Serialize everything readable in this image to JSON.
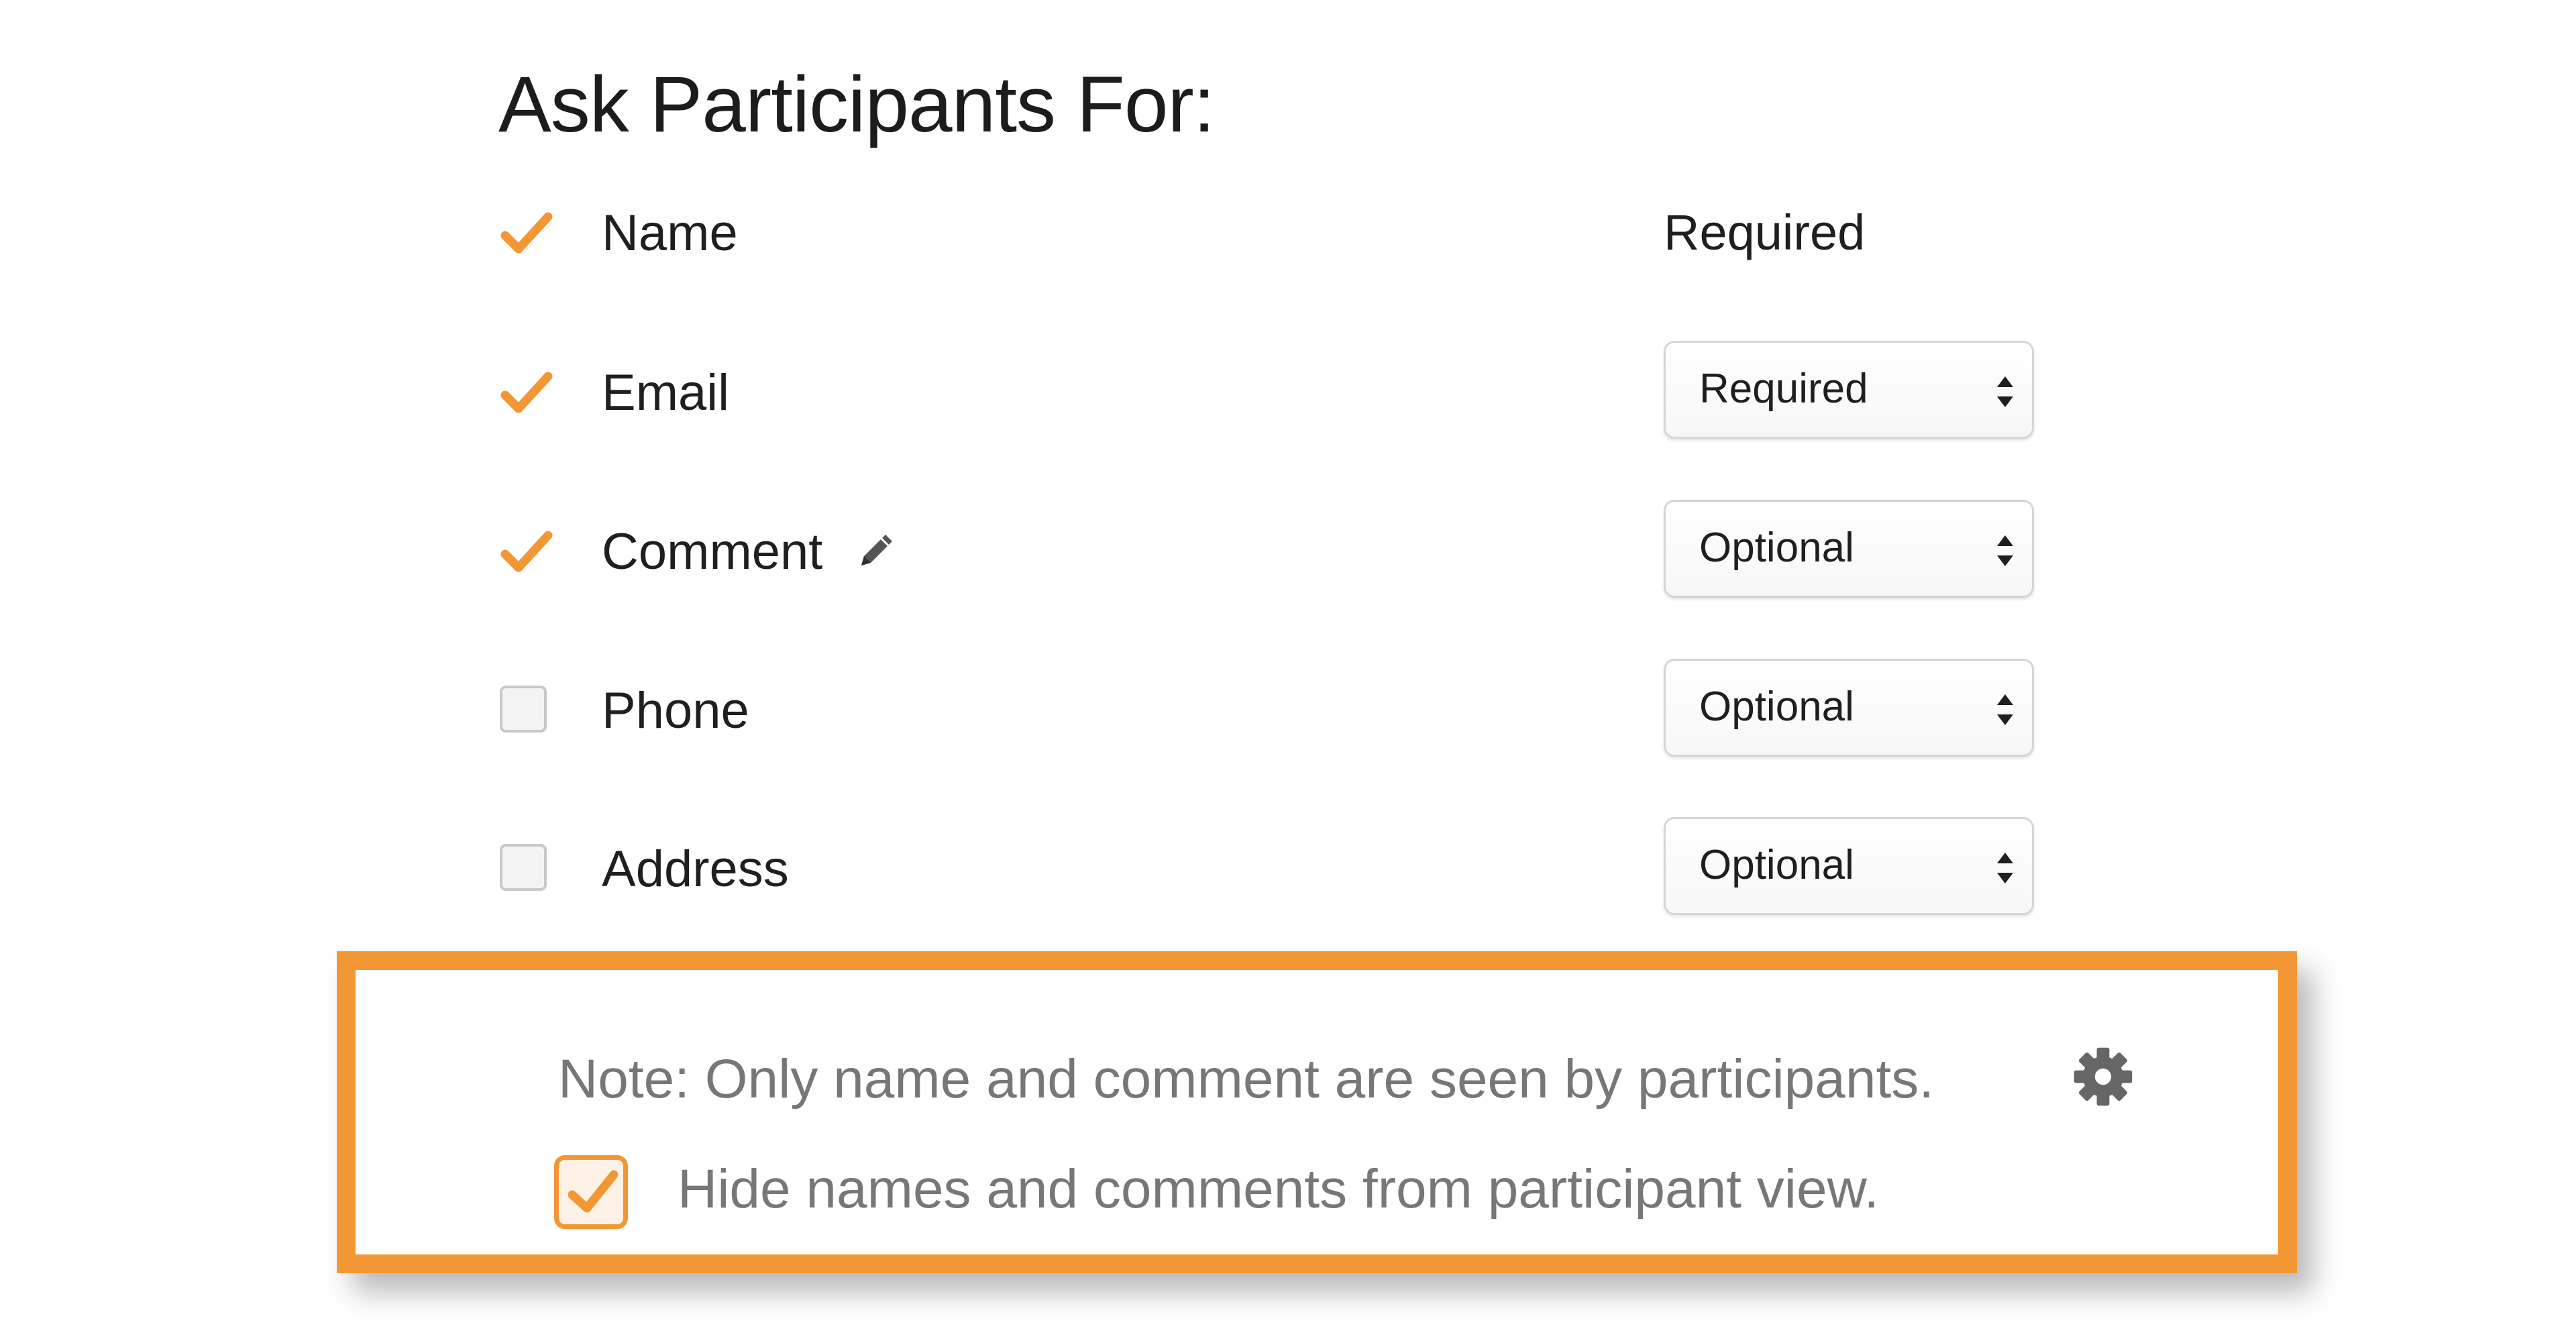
{
  "title": "Ask Participants For:",
  "accent_color": "#f39734",
  "fields": [
    {
      "label": "Name",
      "checked": true,
      "requirement": "Required",
      "editable_requirement": false
    },
    {
      "label": "Email",
      "checked": true,
      "requirement": "Required",
      "editable_requirement": true
    },
    {
      "label": "Comment",
      "checked": true,
      "requirement": "Optional",
      "editable_requirement": true,
      "icon": "pencil-icon"
    },
    {
      "label": "Phone",
      "checked": false,
      "requirement": "Optional",
      "editable_requirement": true
    },
    {
      "label": "Address",
      "checked": false,
      "requirement": "Optional",
      "editable_requirement": true
    }
  ],
  "note": {
    "text": "Note: Only name and comment are seen by participants.",
    "icon": "gear-icon",
    "hide_option": {
      "label": "Hide names and comments from participant view.",
      "checked": true
    }
  }
}
